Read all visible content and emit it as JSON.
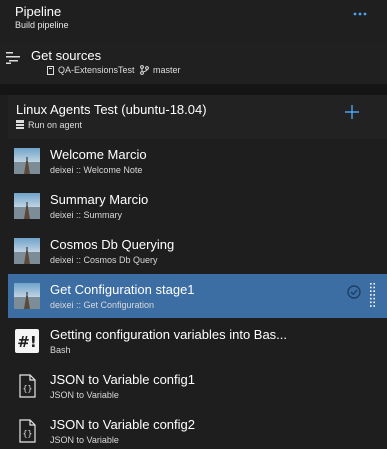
{
  "header": {
    "title": "Pipeline",
    "subtitle": "Build pipeline",
    "more_icon": "ellipsis-icon"
  },
  "sources": {
    "title": "Get sources",
    "repo": "QA-ExtensionsTest",
    "branch": "master",
    "icons": [
      "get-sources-icon",
      "repo-icon",
      "branch-icon"
    ]
  },
  "job": {
    "title": "Linux Agents Test (ubuntu-18.04)",
    "subtitle": "Run on agent",
    "add_icon": "plus-icon"
  },
  "tasks": [
    {
      "name": "Welcome Marcio",
      "detail": "deixei :: Welcome Note",
      "icon": "landscape-icon",
      "selected": false
    },
    {
      "name": "Summary Marcio",
      "detail": "deixei :: Summary",
      "icon": "landscape-icon",
      "selected": false
    },
    {
      "name": "Cosmos Db Querying",
      "detail": "deixei :: Cosmos Db Query",
      "icon": "landscape-icon",
      "selected": false
    },
    {
      "name": "Get Configuration stage1",
      "detail": "deixei :: Get Configuration",
      "icon": "landscape-icon",
      "selected": true
    },
    {
      "name": "Getting configuration variables into Bas...",
      "detail": "Bash",
      "icon": "bash-icon",
      "selected": false
    },
    {
      "name": "JSON to Variable config1",
      "detail": "JSON to Variable",
      "icon": "json-file-icon",
      "selected": false
    },
    {
      "name": "JSON to Variable config2",
      "detail": "JSON to Variable",
      "icon": "json-file-icon",
      "selected": false
    }
  ],
  "colors": {
    "accent": "#4aa3f0",
    "selected": "#3c6da3",
    "background": "#1e1e1e"
  }
}
